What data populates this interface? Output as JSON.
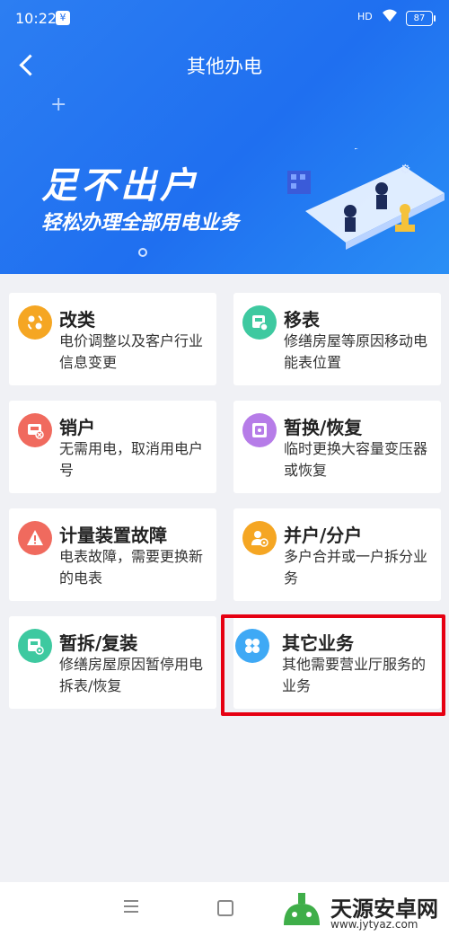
{
  "status_bar": {
    "time": "10:22",
    "sim_badge": "¥",
    "signal": "HD",
    "battery": "87"
  },
  "header": {
    "title": "其他办电"
  },
  "banner": {
    "title": "足不出户",
    "subtitle": "轻松办理全部用电业务"
  },
  "services": [
    {
      "title": "改类",
      "desc": "电价调整以及客户行业信息变更",
      "icon": "swap-icon",
      "color": "#f5a623"
    },
    {
      "title": "移表",
      "desc": "修缮房屋等原因移动电能表位置",
      "icon": "meter-move-icon",
      "color": "#3ec9a0"
    },
    {
      "title": "销户",
      "desc": "无需用电，取消用电户号",
      "icon": "meter-cancel-icon",
      "color": "#f06a5e"
    },
    {
      "title": "暂换/恢复",
      "desc": "临时更换大容量变压器或恢复",
      "icon": "transformer-icon",
      "color": "#b67ce8"
    },
    {
      "title": "计量装置故障",
      "desc": "电表故障，需要更换新的电表",
      "icon": "warning-icon",
      "color": "#f06a5e"
    },
    {
      "title": "并户/分户",
      "desc": "多户合并或一户拆分业务",
      "icon": "user-gear-icon",
      "color": "#f5a623"
    },
    {
      "title": "暂拆/复装",
      "desc": "修缮房屋原因暂停用电拆表/恢复",
      "icon": "meter-pause-icon",
      "color": "#3ec9a0"
    },
    {
      "title": "其它业务",
      "desc": "其他需要营业厅服务的业务",
      "icon": "grid-icon",
      "color": "#3fa9f5"
    }
  ],
  "watermark": {
    "name": "天源安卓网",
    "url": "www.jytyaz.com"
  }
}
